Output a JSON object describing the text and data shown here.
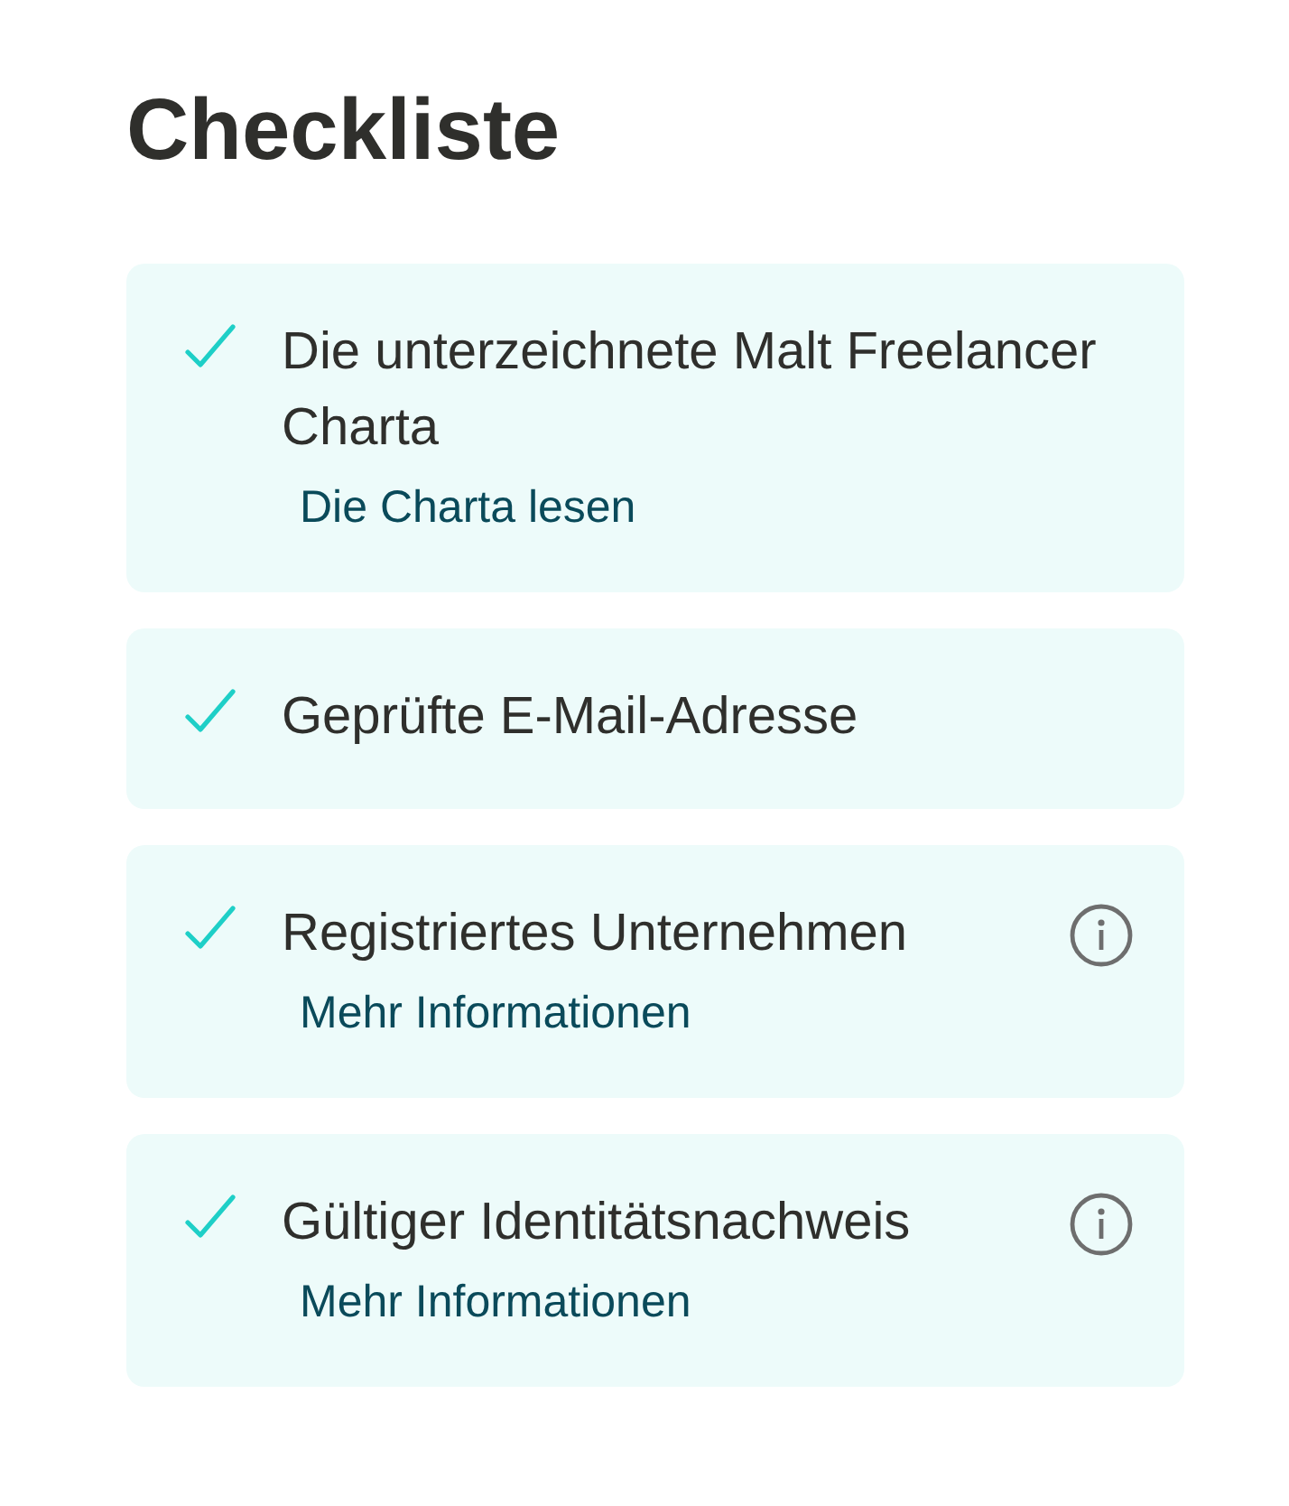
{
  "title": "Checkliste",
  "items": [
    {
      "label": "Die unterzeichnete Malt Freelancer Charta",
      "checked": true,
      "info": false,
      "link": "Die Charta lesen"
    },
    {
      "label": "Geprüfte E-Mail-Adresse",
      "checked": true,
      "info": false
    },
    {
      "label": "Registriertes Unternehmen",
      "checked": true,
      "info": true,
      "link": "Mehr Informationen"
    },
    {
      "label": "Gültiger Identitätsnachweis",
      "checked": true,
      "info": true,
      "link": "Mehr Informationen"
    }
  ]
}
